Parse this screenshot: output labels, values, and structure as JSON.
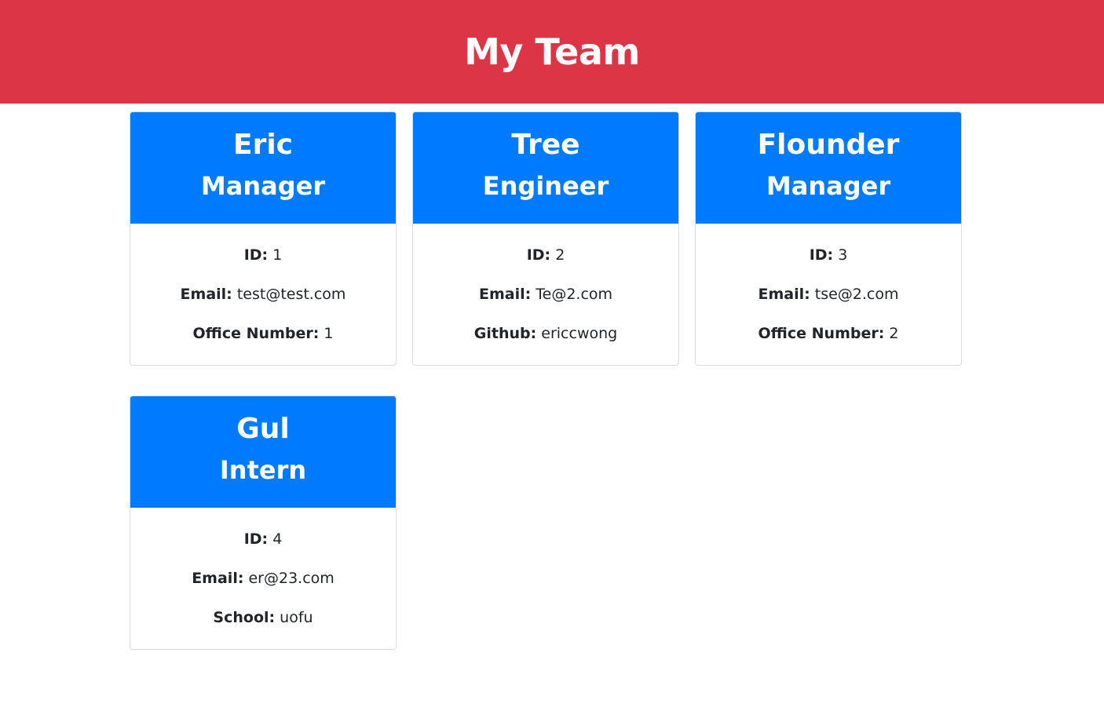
{
  "header": {
    "title": "My Team"
  },
  "colors": {
    "header": "#dc3545",
    "card_header": "#007bff"
  },
  "team": [
    {
      "name": "Eric",
      "role": "Manager",
      "id_label": "ID:",
      "id": "1",
      "email_label": "Email:",
      "email": "test@test.com",
      "extra_label": "Office Number:",
      "extra": "1"
    },
    {
      "name": "Tree",
      "role": "Engineer",
      "id_label": "ID:",
      "id": "2",
      "email_label": "Email:",
      "email": "Te@2.com",
      "extra_label": "Github:",
      "extra": "ericcwong"
    },
    {
      "name": "Flounder",
      "role": "Manager",
      "id_label": "ID:",
      "id": "3",
      "email_label": "Email:",
      "email": "tse@2.com",
      "extra_label": "Office Number:",
      "extra": "2"
    },
    {
      "name": "Gul",
      "role": "Intern",
      "id_label": "ID:",
      "id": "4",
      "email_label": "Email:",
      "email": "er@23.com",
      "extra_label": "School:",
      "extra": "uofu"
    }
  ]
}
